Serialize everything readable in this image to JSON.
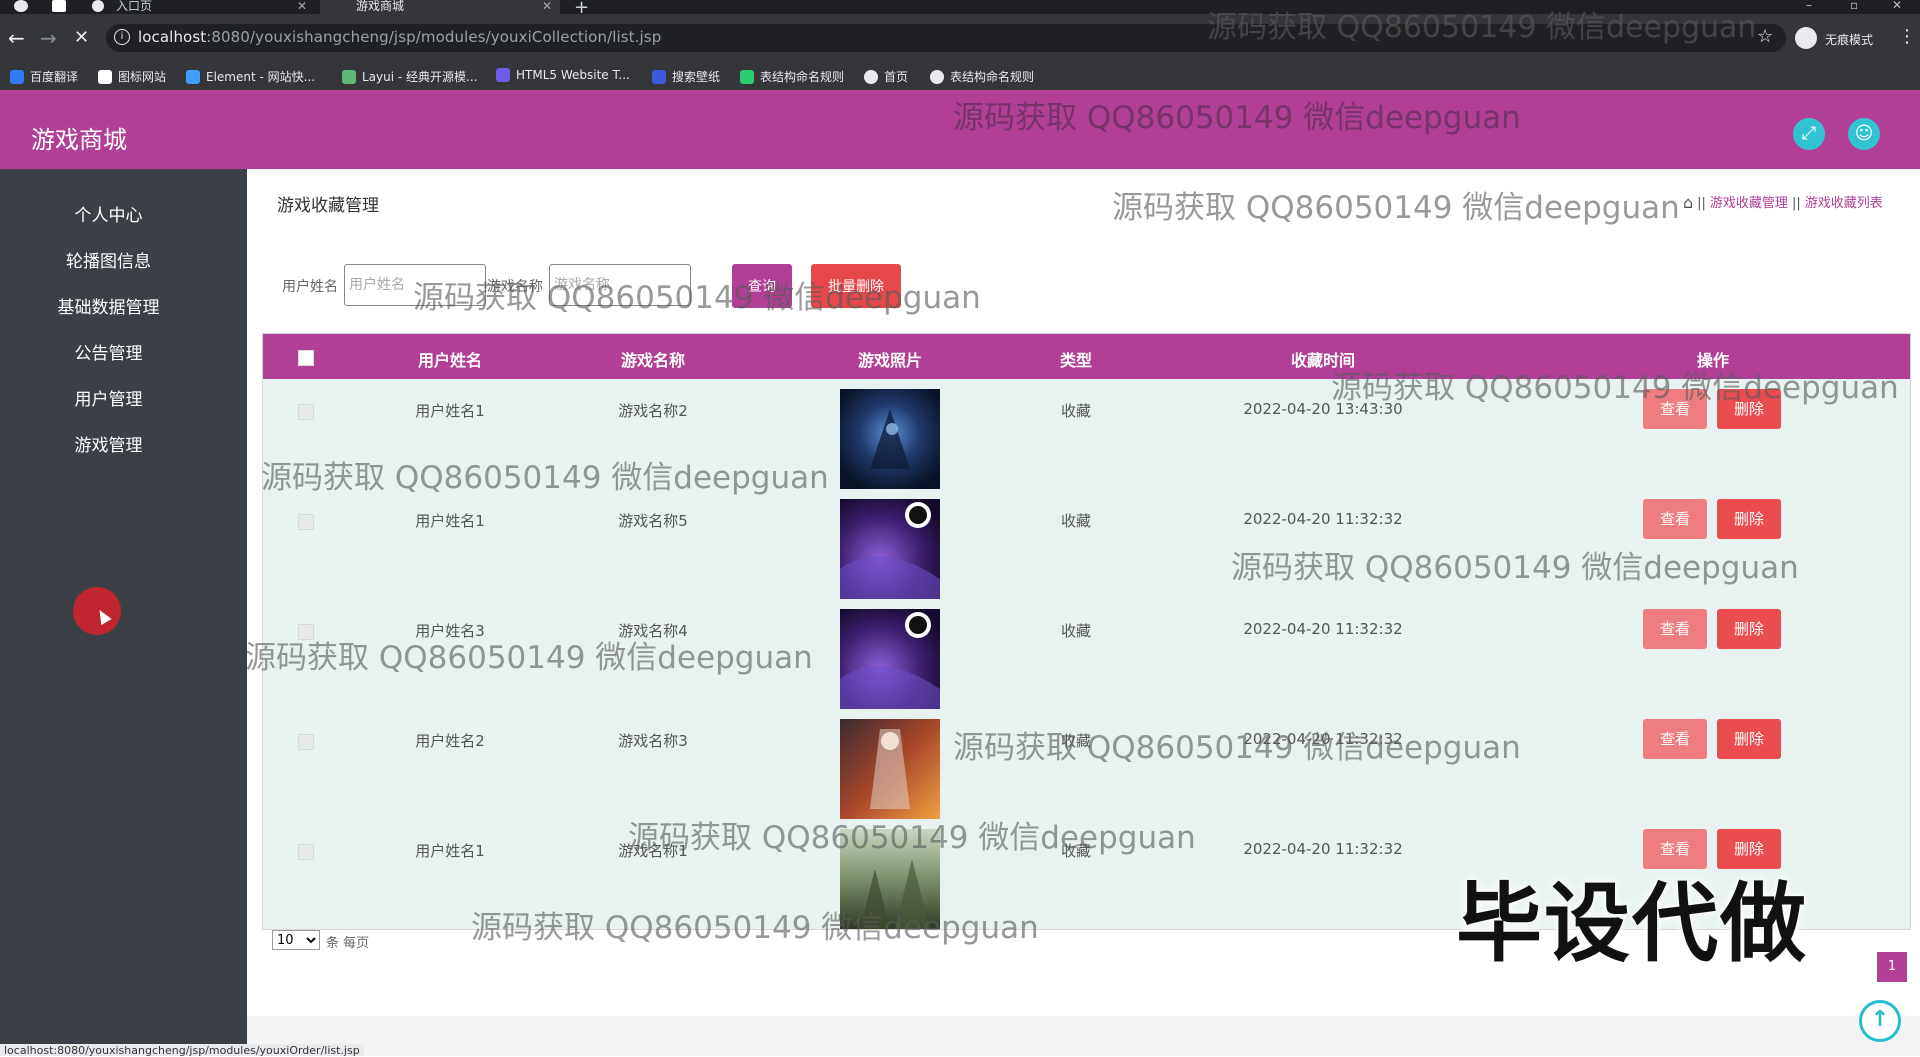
{
  "browser": {
    "tabs": [
      {
        "label": "入口页"
      },
      {
        "label": "游戏商城"
      }
    ],
    "url_host": "localhost",
    "url_rest": ":8080/youxishangcheng/jsp/modules/youxiCollection/list.jsp",
    "incognito_label": "无痕模式",
    "bookmarks": [
      {
        "label": "百度翻译",
        "color": "#2e7cf6"
      },
      {
        "label": "图标网站",
        "color": "#ffffff"
      },
      {
        "label": "Element - 网站快...",
        "color": "#409eff"
      },
      {
        "label": "Layui - 经典开源模...",
        "color": "#5fb878"
      },
      {
        "label": "HTML5 Website T...",
        "color": "#6c5ce7"
      },
      {
        "label": "搜索壁纸",
        "color": "#3b5bdb"
      },
      {
        "label": "表结构命名规则",
        "color": "#2ecc71"
      },
      {
        "label": "首页",
        "color": "#e8eaed"
      },
      {
        "label": "表结构命名规则",
        "color": "#e8eaed"
      }
    ]
  },
  "app": {
    "title": "游戏商城",
    "accent": "#b13f96"
  },
  "sidebar": {
    "items": [
      {
        "label": "个人中心"
      },
      {
        "label": "轮播图信息"
      },
      {
        "label": "基础数据管理"
      },
      {
        "label": "公告管理"
      },
      {
        "label": "用户管理"
      },
      {
        "label": "游戏管理"
      }
    ]
  },
  "page": {
    "title": "游戏收藏管理",
    "breadcrumb": [
      "游戏收藏管理",
      "游戏收藏列表"
    ]
  },
  "search": {
    "user_label": "用户姓名",
    "user_placeholder": "用户姓名",
    "game_label": "游戏名称",
    "game_placeholder": "游戏名称",
    "search_button": "查询",
    "batch_delete_button": "批量删除"
  },
  "table": {
    "columns": [
      "用户姓名",
      "游戏名称",
      "游戏照片",
      "类型",
      "收藏时间",
      "操作"
    ],
    "rows": [
      {
        "user": "用户姓名1",
        "game": "游戏名称2",
        "type": "收藏",
        "time": "2022-04-20 13:43:30",
        "thumb": "dark-blue-warrior"
      },
      {
        "user": "用户姓名1",
        "game": "游戏名称5",
        "type": "收藏",
        "time": "2022-04-20 11:32:32",
        "thumb": "purple-eclipse"
      },
      {
        "user": "用户姓名3",
        "game": "游戏名称4",
        "type": "收藏",
        "time": "2022-04-20 11:32:32",
        "thumb": "purple-eclipse"
      },
      {
        "user": "用户姓名2",
        "game": "游戏名称3",
        "type": "收藏",
        "time": "2022-04-20 11:32:32",
        "thumb": "fire-warrior"
      },
      {
        "user": "用户姓名1",
        "game": "游戏名称1",
        "type": "收藏",
        "time": "2022-04-20 11:32:32",
        "thumb": "forest-scene"
      }
    ],
    "view_button": "查看",
    "delete_button": "删除"
  },
  "pagination": {
    "page_size": "10",
    "page_size_label": "条 每页",
    "current_page": "1"
  },
  "status_url": "localhost:8080/youxishangcheng/jsp/modules/youxiOrder/list.jsp",
  "watermark": "源码获取 QQ86050149 微信deepguan",
  "big_watermark": "毕设代做"
}
